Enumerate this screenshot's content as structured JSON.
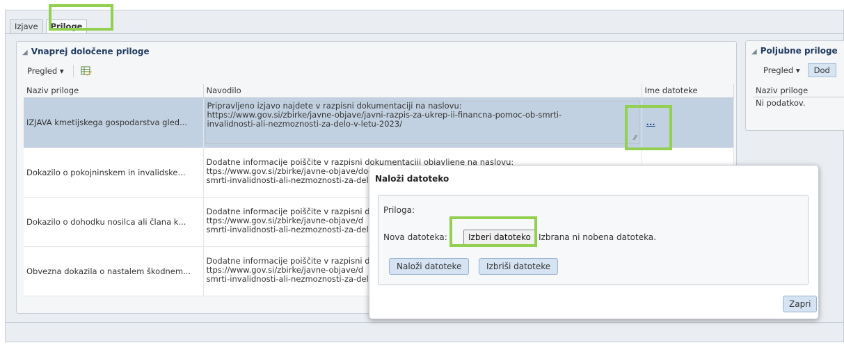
{
  "tabs": [
    "Izjave",
    "Priloge"
  ],
  "predefined": {
    "title": "Vnaprej določene priloge",
    "view_label": "Pregled",
    "columns": [
      "Naziv priloge",
      "Navodilo",
      "Ime datoteke"
    ],
    "rows": [
      {
        "name": "IZJAVA kmetijskega gospodarstva gled...",
        "instructions": "Pripravljeno izjavo najdete v razpisni  dokumentaciji na naslovu:\nhttps://www.gov.si/zbirke/javne-objave/javni-razpis-za-ukrep-ii-financna-pomoc-ob-smrti-\ninvalidnosti-ali-nezmoznosti-za-delo-v-letu-2023/",
        "file": "..."
      },
      {
        "name": "Dokazilo o pokojninskem in invalidske...",
        "instructions": "Dodatne informacije poiščite v razpisni dokumentaciji objavljene na naslovu:\nttps://www.gov.si/zbirke/javne-objave/dodatne-razpis-za-ukrep-ii-financna-pomoc-ob-\nsmrti-invalidnosti-ali-nezmoznosti-za-del",
        "file": ""
      },
      {
        "name": "Dokazilo o dohodku nosilca ali člana k...",
        "instructions": "Dodatne informacije poiščite v razpisni d\nttps://www.gov.si/zbirke/javne-objave/d\nsmrti-invalidnosti-ali-nezmoznosti-za-del",
        "file": ""
      },
      {
        "name": "Obvezna dokazila o nastalem škodnem...",
        "instructions": "Dodatne informacije poiščite v razpisni d\nttps://www.gov.si/zbirke/javne-objave/d\nsmrti-invalidnosti-ali-nezmoznosti-za-del",
        "file": ""
      }
    ]
  },
  "optional": {
    "title": "Poljubne priloge",
    "view_label": "Pregled",
    "add_label": "Dod",
    "column": "Naziv priloge",
    "empty": "Ni podatkov."
  },
  "dialog": {
    "title": "Naloži datoteko",
    "attachment_label": "Priloga:",
    "new_file_label": "Nova datoteka:",
    "choose_button": "Izberi datoteko",
    "no_file_text": "Izbrana ni nobena datoteka.",
    "upload_button": "Naloži datoteke",
    "delete_button": "Izbriši datoteke",
    "close_button": "Zapri"
  },
  "colors": {
    "highlight": "#92d050",
    "selected_row": "#c2d1e1",
    "title_text": "#213b61"
  }
}
